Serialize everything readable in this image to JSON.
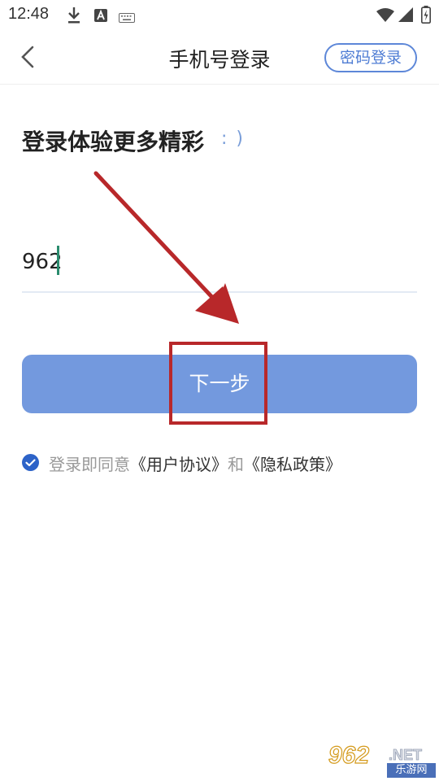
{
  "status_bar": {
    "time": "12:48",
    "icons": [
      "download-icon",
      "a-app-icon",
      "keyboard-icon",
      "wifi-icon",
      "signal-icon",
      "battery-icon"
    ]
  },
  "header": {
    "title": "手机号登录",
    "password_login_label": "密码登录"
  },
  "main": {
    "headline": "登录体验更多精彩",
    "headline_emoticon": ": )",
    "phone_value": "962",
    "next_label": "下一步"
  },
  "agreement": {
    "checked": true,
    "prefix": "登录即同意",
    "user_agreement": "《用户协议》",
    "conjunction": "和",
    "privacy_policy": "《隐私政策》"
  },
  "annotation": {
    "color": "#b8282a"
  },
  "watermark": {
    "number": "962",
    "net": ".NET",
    "site": "乐游网"
  },
  "colors": {
    "accent": "#7399de",
    "link_border": "#5d87d8",
    "checkbox": "#2d63c8"
  }
}
